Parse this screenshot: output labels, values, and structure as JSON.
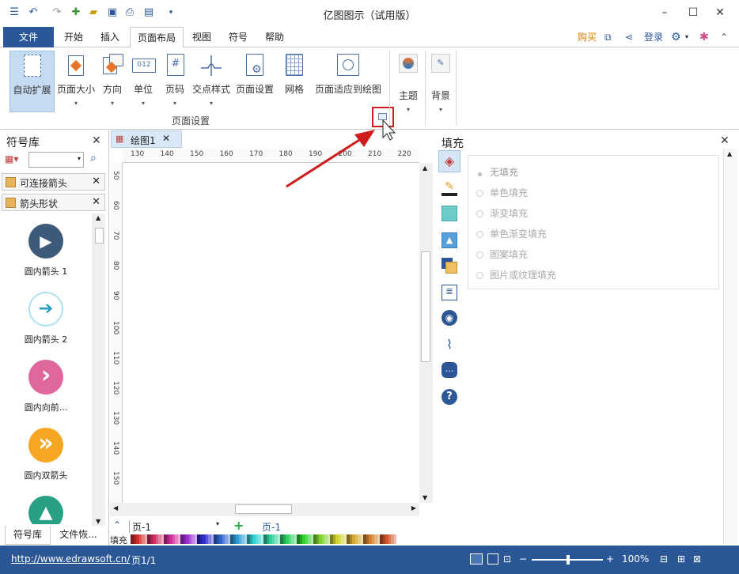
{
  "app": {
    "title": "亿图图示（试用版）"
  },
  "menu": {
    "file": "文件",
    "items": [
      "开始",
      "插入",
      "页面布局",
      "视图",
      "符号",
      "帮助"
    ],
    "active": "页面布局",
    "buy": "购买",
    "login": "登录"
  },
  "ribbon": {
    "buttons": [
      "自动扩展",
      "页面大小",
      "方向",
      "单位",
      "页码",
      "交点样式",
      "页面设置",
      "网格",
      "页面适应到绘图"
    ],
    "unit_icon_text": "012",
    "group_label": "页面设置",
    "theme": "主题",
    "background": "背景"
  },
  "library": {
    "title": "符号库",
    "tabs": [
      "可连接箭头",
      "箭头形状"
    ],
    "shapes": [
      {
        "name": "圆内箭头 1",
        "color": "#3d5a7a",
        "glyph": "▶"
      },
      {
        "name": "圆内箭头 2",
        "color": "#ffffff",
        "glyph": "➔"
      },
      {
        "name": "圆内向前...",
        "color": "#e0679b",
        "glyph": "›"
      },
      {
        "name": "圆内双箭头",
        "color": "#f5a623",
        "glyph": "»"
      },
      {
        "name": "",
        "color": "#27a085",
        "glyph": "▲"
      }
    ],
    "bottom_tabs": [
      "符号库",
      "文件恢..."
    ]
  },
  "document": {
    "tab": "绘图1",
    "hruler": [
      "130",
      "140",
      "150",
      "160",
      "170",
      "180",
      "190",
      "200",
      "210",
      "220"
    ],
    "vruler": [
      "50",
      "60",
      "70",
      "80",
      "90",
      "100",
      "110",
      "120",
      "130",
      "140",
      "150"
    ],
    "page_select": "页-1",
    "page_tab": "页-1",
    "fill_label": "填充"
  },
  "fill": {
    "title": "填充",
    "options": [
      "无填充",
      "单色填充",
      "渐变填充",
      "单色渐变填充",
      "图案填充",
      "图片或纹理填充"
    ]
  },
  "status": {
    "url": "http://www.edrawsoft.cn/",
    "page": "页1/1",
    "zoom": "100%"
  },
  "colors": {
    "accent": "#2b5797",
    "highlight": "#d01c1c"
  }
}
